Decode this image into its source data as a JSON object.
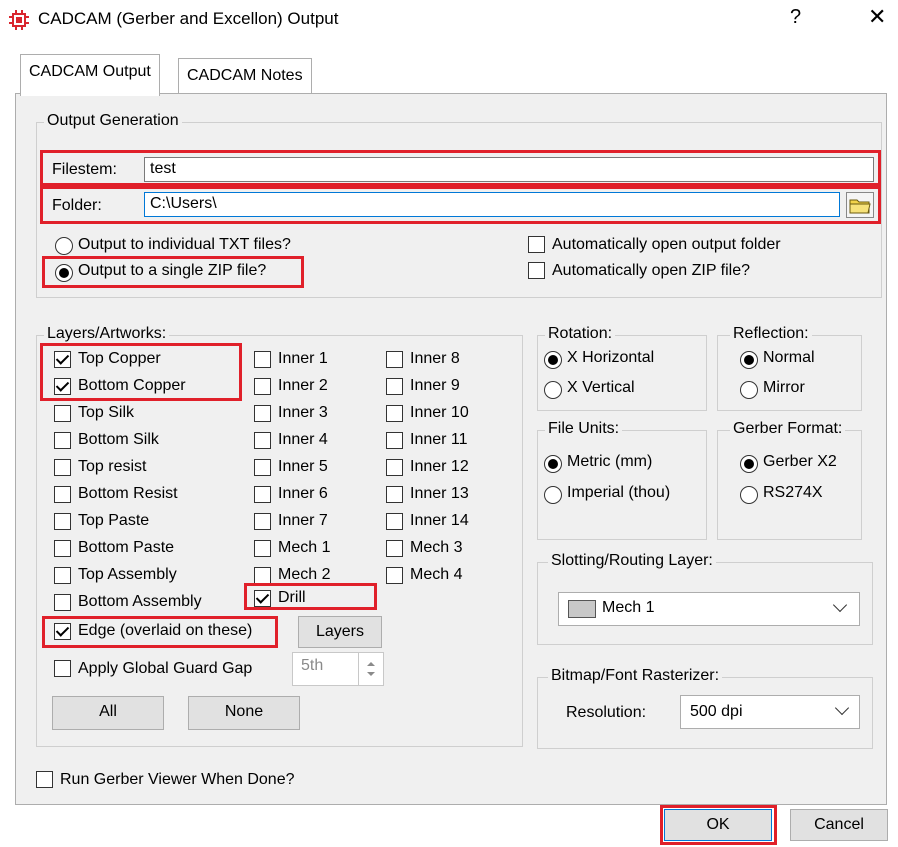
{
  "window": {
    "title": "CADCAM (Gerber and Excellon) Output",
    "help_label": "?",
    "close_label": "✕"
  },
  "tabs": [
    {
      "label": "CADCAM Output"
    },
    {
      "label": "CADCAM Notes"
    }
  ],
  "output_generation": {
    "group_label": "Output Generation",
    "filestem_label": "Filestem:",
    "filestem_value": "test",
    "folder_label": "Folder:",
    "folder_value": "C:\\Users\\",
    "output_options": [
      {
        "label": "Output to individual TXT files?",
        "selected": false
      },
      {
        "label": "Output to a single ZIP file?",
        "selected": true
      }
    ],
    "auto_open_folder": "Automatically open output folder",
    "auto_open_zip": "Automatically open ZIP file?"
  },
  "layers": {
    "group_label": "Layers/Artworks:",
    "col1": [
      {
        "label": "Top Copper",
        "checked": true
      },
      {
        "label": "Bottom Copper",
        "checked": true
      },
      {
        "label": "Top Silk",
        "checked": false
      },
      {
        "label": "Bottom Silk",
        "checked": false
      },
      {
        "label": "Top resist",
        "checked": false
      },
      {
        "label": "Bottom Resist",
        "checked": false
      },
      {
        "label": "Top Paste",
        "checked": false
      },
      {
        "label": "Bottom Paste",
        "checked": false
      },
      {
        "label": "Top Assembly",
        "checked": false
      },
      {
        "label": "Bottom Assembly",
        "checked": false
      }
    ],
    "col2": [
      {
        "label": "Inner 1",
        "checked": false
      },
      {
        "label": "Inner 2",
        "checked": false
      },
      {
        "label": "Inner 3",
        "checked": false
      },
      {
        "label": "Inner 4",
        "checked": false
      },
      {
        "label": "Inner 5",
        "checked": false
      },
      {
        "label": "Inner 6",
        "checked": false
      },
      {
        "label": "Inner 7",
        "checked": false
      },
      {
        "label": "Mech 1",
        "checked": false
      },
      {
        "label": "Mech 2",
        "checked": false
      },
      {
        "label": "Drill",
        "checked": true
      }
    ],
    "col3": [
      {
        "label": "Inner 8",
        "checked": false
      },
      {
        "label": "Inner 9",
        "checked": false
      },
      {
        "label": "Inner 10",
        "checked": false
      },
      {
        "label": "Inner 11",
        "checked": false
      },
      {
        "label": "Inner 12",
        "checked": false
      },
      {
        "label": "Inner 13",
        "checked": false
      },
      {
        "label": "Inner 14",
        "checked": false
      },
      {
        "label": "Mech 3",
        "checked": false
      },
      {
        "label": "Mech 4",
        "checked": false
      }
    ],
    "edge_label": "Edge (overlaid on these)",
    "edge_checked": true,
    "layers_button": "Layers",
    "guard_gap_label": "Apply Global Guard Gap",
    "guard_gap_checked": false,
    "guard_gap_value": "5th",
    "all_button": "All",
    "none_button": "None"
  },
  "rotation": {
    "group_label": "Rotation:",
    "options": [
      {
        "label": "X Horizontal",
        "selected": true
      },
      {
        "label": "X Vertical",
        "selected": false
      }
    ]
  },
  "reflection": {
    "group_label": "Reflection:",
    "options": [
      {
        "label": "Normal",
        "selected": true
      },
      {
        "label": "Mirror",
        "selected": false
      }
    ]
  },
  "file_units": {
    "group_label": "File Units:",
    "options": [
      {
        "label": "Metric (mm)",
        "selected": true
      },
      {
        "label": "Imperial (thou)",
        "selected": false
      }
    ]
  },
  "gerber_format": {
    "group_label": "Gerber Format:",
    "options": [
      {
        "label": "Gerber X2",
        "selected": true
      },
      {
        "label": "RS274X",
        "selected": false
      }
    ]
  },
  "slotting": {
    "group_label": "Slotting/Routing Layer:",
    "value": "Mech 1",
    "swatch_color": "#c8c8c8"
  },
  "bitmap": {
    "group_label": "Bitmap/Font Rasterizer:",
    "resolution_label": "Resolution:",
    "resolution_value": "500 dpi"
  },
  "run_viewer": {
    "label": "Run Gerber Viewer When Done?",
    "checked": false
  },
  "buttons": {
    "ok": "OK",
    "cancel": "Cancel"
  },
  "colors": {
    "highlight": "#e0202a",
    "dialog_bg": "#f0f0f0",
    "app_icon": "#d9262e"
  }
}
